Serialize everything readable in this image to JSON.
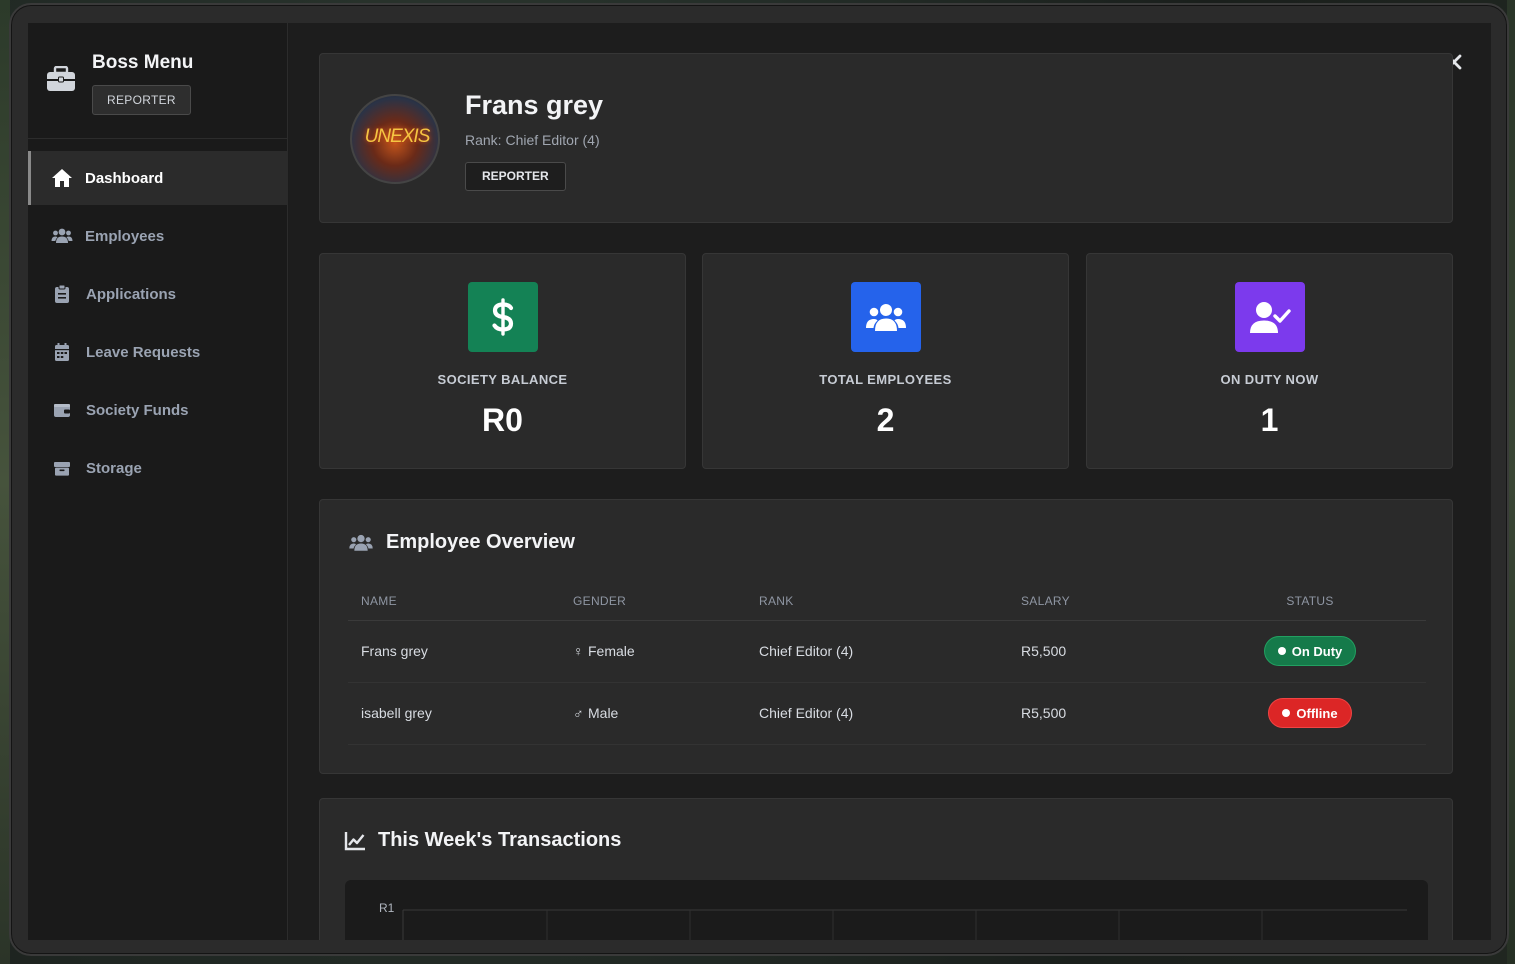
{
  "sidebar": {
    "title": "Boss Menu",
    "job_badge": "REPORTER",
    "items": [
      {
        "label": "Dashboard",
        "icon": "home-icon",
        "active": true
      },
      {
        "label": "Employees",
        "icon": "users-icon",
        "active": false
      },
      {
        "label": "Applications",
        "icon": "clipboard-icon",
        "active": false
      },
      {
        "label": "Leave Requests",
        "icon": "calendar-icon",
        "active": false
      },
      {
        "label": "Society Funds",
        "icon": "wallet-icon",
        "active": false
      },
      {
        "label": "Storage",
        "icon": "box-icon",
        "active": false
      }
    ]
  },
  "profile": {
    "name": "Frans grey",
    "rank": "Rank: Chief Editor (4)",
    "job_badge": "REPORTER",
    "avatar_text": "UNEXIS"
  },
  "stats": [
    {
      "label": "SOCIETY BALANCE",
      "value": "R0",
      "icon": "dollar-icon",
      "color": "#148255"
    },
    {
      "label": "TOTAL EMPLOYEES",
      "value": "2",
      "icon": "users-icon",
      "color": "#2563eb"
    },
    {
      "label": "ON DUTY NOW",
      "value": "1",
      "icon": "user-check-icon",
      "color": "#7c3aed"
    }
  ],
  "employee_overview": {
    "title": "Employee Overview",
    "columns": [
      "NAME",
      "GENDER",
      "RANK",
      "SALARY",
      "STATUS"
    ],
    "rows": [
      {
        "name": "Frans grey",
        "gender_symbol": "♀",
        "gender": "Female",
        "rank": "Chief Editor (4)",
        "salary": "R5,500",
        "status": "On Duty"
      },
      {
        "name": "isabell grey",
        "gender_symbol": "♂",
        "gender": "Male",
        "rank": "Chief Editor (4)",
        "salary": "R5,500",
        "status": "Offline"
      }
    ]
  },
  "transactions": {
    "title": "This Week's Transactions",
    "y_tick_top": "R1"
  },
  "colors": {
    "on_duty": "#157a4a",
    "offline": "#dc2626"
  }
}
